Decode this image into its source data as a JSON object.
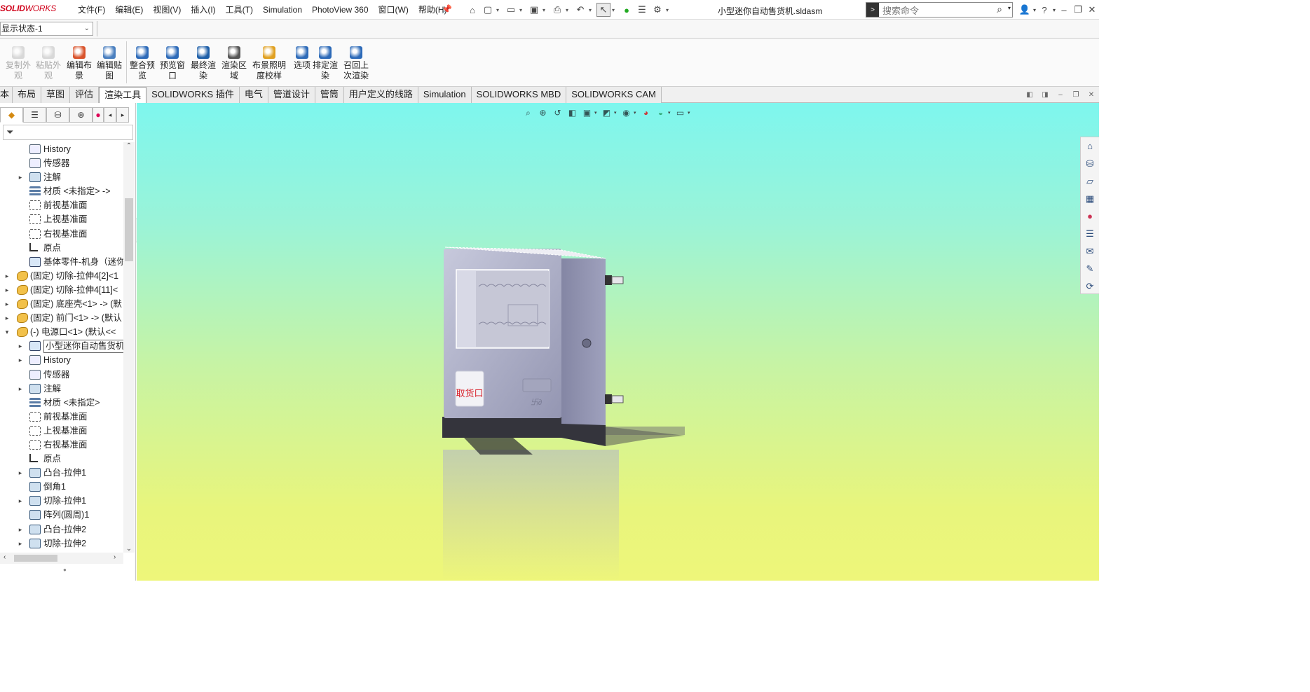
{
  "app": {
    "logo_solid": "SOLID",
    "logo_works": "WORKS",
    "menus": [
      "文件(F)",
      "编辑(E)",
      "视图(V)",
      "插入(I)",
      "工具(T)",
      "Simulation",
      "PhotoView 360",
      "窗口(W)",
      "帮助(H)"
    ],
    "pin_icon": "pin-icon",
    "file_title": "小型迷你自动售货机.sldasm",
    "search_placeholder": "搜索命令",
    "quick_access": [
      "home-icon",
      "new-file-icon",
      "open-icon",
      "save-icon",
      "print-icon",
      "undo-icon",
      "select-icon",
      "traffic-light-icon",
      "file-properties-icon",
      "gear-icon"
    ],
    "window_controls": [
      "user-icon",
      "help-icon",
      "minimize-icon",
      "restore-icon",
      "close-icon"
    ]
  },
  "config": {
    "display_state": "显示状态-1"
  },
  "ribbon": {
    "buttons": [
      {
        "label": "复制外观",
        "enabled": false,
        "color": "#9a9a9a"
      },
      {
        "label": "粘贴外观",
        "enabled": false,
        "color": "#9a9a9a"
      },
      {
        "label": "编辑布景",
        "enabled": true,
        "color": "#d9532b"
      },
      {
        "label": "编辑贴图",
        "enabled": true,
        "color": "#4a7fbf"
      },
      {
        "label": "整合预览",
        "enabled": true,
        "color": "#2d6ab8"
      },
      {
        "label": "预览窗口",
        "enabled": true,
        "color": "#2d6ab8"
      },
      {
        "label": "最终渲染",
        "enabled": true,
        "color": "#1e5fa8"
      },
      {
        "label": "渲染区域",
        "enabled": true,
        "color": "#555555"
      },
      {
        "label": "布景照明度校样",
        "enabled": true,
        "color": "#e0a020"
      },
      {
        "label": "选项",
        "enabled": true,
        "color": "#2d6ab8"
      },
      {
        "label": "排定渲染",
        "enabled": true,
        "color": "#2d6ab8"
      },
      {
        "label": "召回上次渲染",
        "enabled": true,
        "color": "#2d6ab8"
      }
    ]
  },
  "tabs": {
    "items": [
      "本",
      "布局",
      "草图",
      "评估",
      "渲染工具",
      "SOLIDWORKS 插件",
      "电气",
      "管道设计",
      "管筒",
      "用户定义的线路",
      "Simulation",
      "SOLIDWORKS MBD",
      "SOLIDWORKS CAM"
    ],
    "active": "渲染工具"
  },
  "panel": {
    "tab_icons": [
      "feature-manager-icon",
      "property-manager-icon",
      "configuration-manager-icon",
      "dimxpert-icon",
      "display-manager-icon"
    ],
    "filter_icon": "filter-icon"
  },
  "tree": [
    {
      "indent": 2,
      "expand": "",
      "icon": "hist",
      "label": "History"
    },
    {
      "indent": 2,
      "expand": "",
      "icon": "hist",
      "label": "传感器"
    },
    {
      "indent": 2,
      "expand": "▸",
      "icon": "feat",
      "label": "注解"
    },
    {
      "indent": 2,
      "expand": "",
      "icon": "mat",
      "label": "材质 <未指定> ->"
    },
    {
      "indent": 2,
      "expand": "",
      "icon": "plane",
      "label": "前视基准面"
    },
    {
      "indent": 2,
      "expand": "",
      "icon": "plane",
      "label": "上视基准面"
    },
    {
      "indent": 2,
      "expand": "",
      "icon": "plane",
      "label": "右视基准面"
    },
    {
      "indent": 2,
      "expand": "",
      "icon": "origin",
      "label": "原点"
    },
    {
      "indent": 2,
      "expand": "",
      "icon": "base",
      "label": "基体零件-机身（迷你"
    },
    {
      "indent": 1,
      "expand": "▸",
      "icon": "asm",
      "label": "(固定) 切除-拉伸4[2]<1"
    },
    {
      "indent": 1,
      "expand": "▸",
      "icon": "asm",
      "label": "(固定) 切除-拉伸4[11]<"
    },
    {
      "indent": 1,
      "expand": "▸",
      "icon": "asm",
      "label": "(固定) 底座壳<1> -> (默"
    },
    {
      "indent": 1,
      "expand": "▸",
      "icon": "asm",
      "label": "(固定) 前门<1> -> (默认"
    },
    {
      "indent": 1,
      "expand": "▾",
      "icon": "asm",
      "label": "(-) 电源口<1> (默认<<"
    },
    {
      "indent": 2,
      "expand": "▸",
      "icon": "base",
      "label": "小型迷你自动售货机",
      "selbox": true
    },
    {
      "indent": 2,
      "expand": "▸",
      "icon": "hist",
      "label": "History"
    },
    {
      "indent": 2,
      "expand": "",
      "icon": "hist",
      "label": "传感器"
    },
    {
      "indent": 2,
      "expand": "▸",
      "icon": "feat",
      "label": "注解"
    },
    {
      "indent": 2,
      "expand": "",
      "icon": "mat",
      "label": "材质 <未指定>"
    },
    {
      "indent": 2,
      "expand": "",
      "icon": "plane",
      "label": "前视基准面"
    },
    {
      "indent": 2,
      "expand": "",
      "icon": "plane",
      "label": "上视基准面"
    },
    {
      "indent": 2,
      "expand": "",
      "icon": "plane",
      "label": "右视基准面"
    },
    {
      "indent": 2,
      "expand": "",
      "icon": "origin",
      "label": "原点"
    },
    {
      "indent": 2,
      "expand": "▸",
      "icon": "feat",
      "label": "凸台-拉伸1"
    },
    {
      "indent": 2,
      "expand": "",
      "icon": "feat",
      "label": "倒角1"
    },
    {
      "indent": 2,
      "expand": "▸",
      "icon": "feat",
      "label": "切除-拉伸1"
    },
    {
      "indent": 2,
      "expand": "",
      "icon": "feat",
      "label": "阵列(圆周)1"
    },
    {
      "indent": 2,
      "expand": "▸",
      "icon": "feat",
      "label": "凸台-拉伸2"
    },
    {
      "indent": 2,
      "expand": "▸",
      "icon": "feat",
      "label": "切除-拉伸2"
    }
  ],
  "viewport": {
    "hud_icons": [
      "zoom-to-fit-icon",
      "zoom-area-icon",
      "previous-view-icon",
      "section-view-icon",
      "view-orientation-icon",
      "display-style-icon",
      "hide-show-icon",
      "edit-appearance-icon",
      "apply-scene-icon",
      "view-settings-icon"
    ],
    "task_pane_icons": [
      "solidworks-resources-icon",
      "design-library-icon",
      "file-explorer-icon",
      "view-palette-icon",
      "appearances-icon",
      "custom-properties-icon",
      "forum-icon",
      "solidworks-add-in-icon",
      "3d-experience-icon"
    ],
    "model_label": "取货口"
  }
}
